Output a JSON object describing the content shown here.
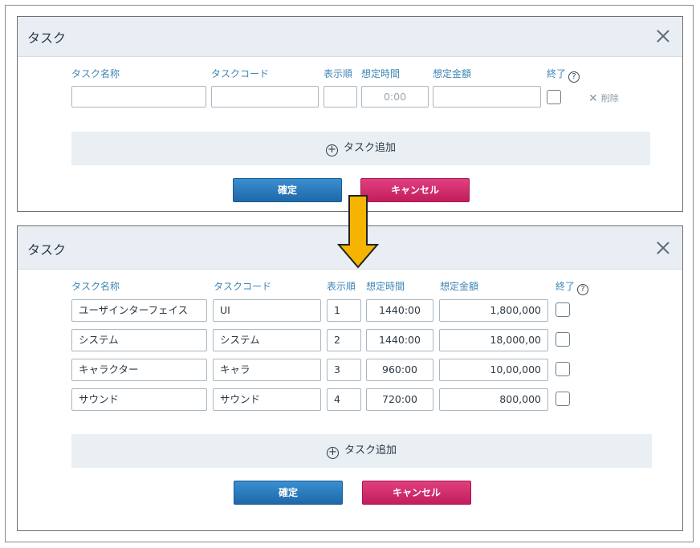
{
  "before": {
    "title": "タスク",
    "columns": {
      "name": "タスク名称",
      "code": "タスクコード",
      "order": "表示順",
      "time": "想定時間",
      "amount": "想定金額",
      "done": "終了"
    },
    "row": {
      "name": "",
      "code": "",
      "order": "",
      "time": "0:00",
      "amount": "",
      "done": false
    },
    "delete_label": "削除",
    "add_label": "タスク追加",
    "confirm_label": "確定",
    "cancel_label": "キャンセル"
  },
  "after": {
    "title": "タスク",
    "columns": {
      "name": "タスク名称",
      "code": "タスクコード",
      "order": "表示順",
      "time": "想定時間",
      "amount": "想定金額",
      "done": "終了"
    },
    "rows": [
      {
        "name": "ユーザインターフェイス",
        "code": "UI",
        "order": "1",
        "time": "1440:00",
        "amount": "1,800,000",
        "done": false
      },
      {
        "name": "システム",
        "code": "システム",
        "order": "2",
        "time": "1440:00",
        "amount": "18,000,00",
        "done": false
      },
      {
        "name": "キャラクター",
        "code": "キャラ",
        "order": "3",
        "time": "960:00",
        "amount": "10,00,000",
        "done": false
      },
      {
        "name": "サウンド",
        "code": "サウンド",
        "order": "4",
        "time": "720:00",
        "amount": "800,000",
        "done": false
      }
    ],
    "add_label": "タスク追加",
    "confirm_label": "確定",
    "cancel_label": "キャンセル"
  },
  "icons": {
    "close": "close-icon",
    "help": "help-circle-icon",
    "add": "plus-circle-icon",
    "delete": "x-icon",
    "transition": "down-arrow"
  },
  "colors": {
    "header_bg": "#e8eef3",
    "accent_label": "#3f86b6",
    "confirm_button": "#1f68a8",
    "cancel_button": "#c21d5d",
    "arrow": "#f5b400"
  }
}
